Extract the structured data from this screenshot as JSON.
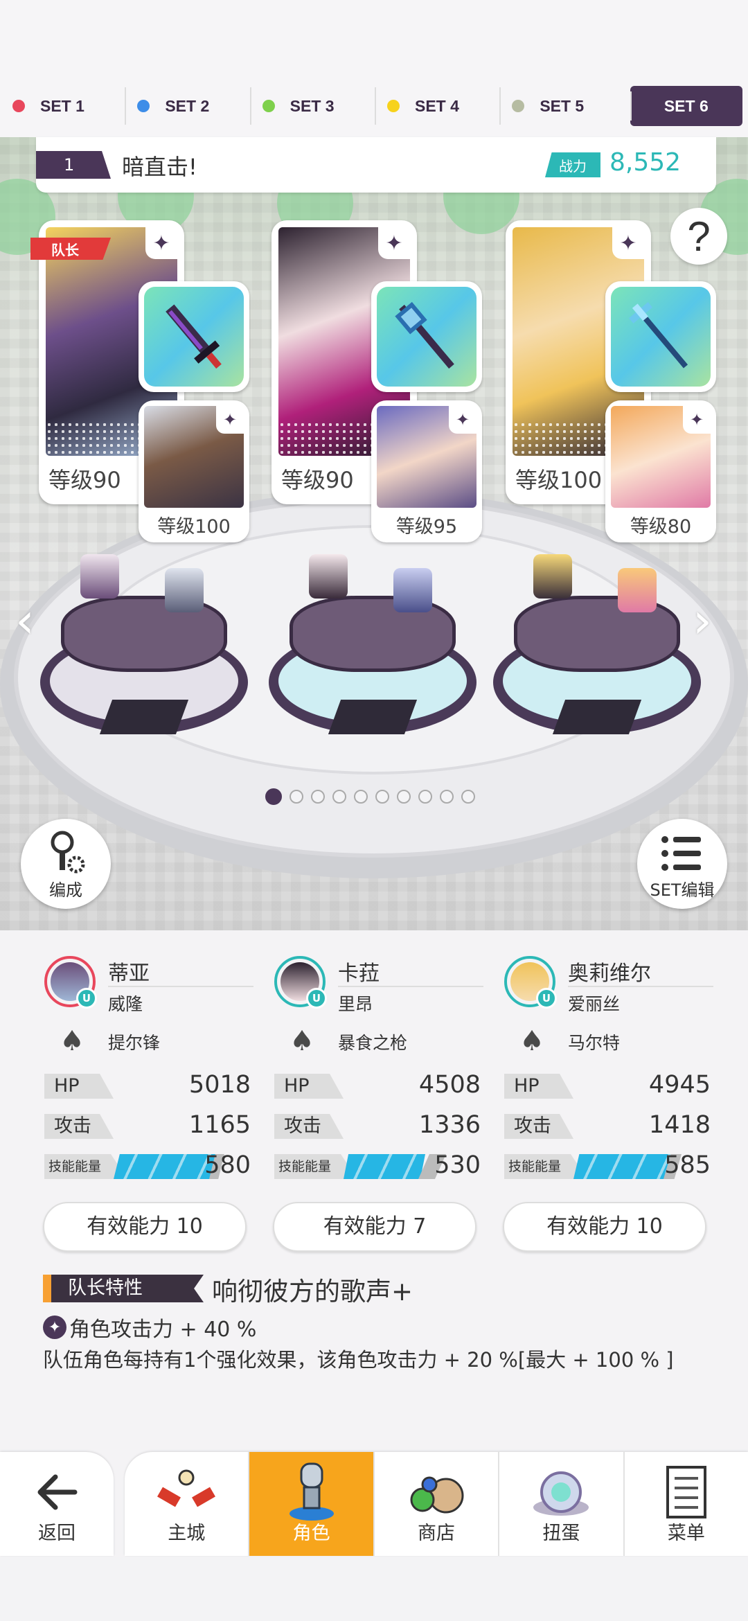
{
  "set_tabs": [
    {
      "label": "SET 1",
      "color": "#e8475c"
    },
    {
      "label": "SET 2",
      "color": "#3d8de8"
    },
    {
      "label": "SET 3",
      "color": "#7ed04c"
    },
    {
      "label": "SET 4",
      "color": "#f7d21c"
    },
    {
      "label": "SET 5",
      "color": "#b6bca2"
    },
    {
      "label": "SET 6",
      "color": "#4a3658",
      "active": true
    }
  ],
  "team": {
    "number": "1",
    "name": "暗直击!",
    "power_label": "战力",
    "power_value": "8,552"
  },
  "captain_label": "队长",
  "help_symbol": "?",
  "cards": [
    {
      "level": "等级90",
      "sub_level": "等级100"
    },
    {
      "level": "等级90",
      "sub_level": "等级95"
    },
    {
      "level": "等级100",
      "sub_level": "等级80"
    }
  ],
  "pager": {
    "total": 10,
    "current": 1
  },
  "buttons": {
    "formation": "编成",
    "set_edit": "SET编辑"
  },
  "characters": [
    {
      "name": "蒂亚",
      "sub": "威隆",
      "weapon": "提尔锋",
      "hp": "5018",
      "atk": "1165",
      "skill": "580",
      "effective": "有效能力 10"
    },
    {
      "name": "卡菈",
      "sub": "里昂",
      "weapon": "暴食之枪",
      "hp": "4508",
      "atk": "1336",
      "skill": "530",
      "effective": "有效能力 7"
    },
    {
      "name": "奥莉维尔",
      "sub": "爱丽丝",
      "weapon": "马尔特",
      "hp": "4945",
      "atk": "1418",
      "skill": "585",
      "effective": "有效能力 10"
    }
  ],
  "stat_labels": {
    "hp": "HP",
    "atk": "攻击",
    "skill": "技能能量"
  },
  "u_badge": "U",
  "trait": {
    "label": "队长特性",
    "title": "响彻彼方的歌声+",
    "line1": "角色攻击力 + 40 %",
    "line2": "队伍角色每持有1个强化效果，该角色攻击力 + 20 %[最大 + 100 % ]"
  },
  "nav": {
    "back": "返回",
    "tabs": [
      "主城",
      "角色",
      "商店",
      "扭蛋",
      "菜单"
    ],
    "active": "角色"
  }
}
